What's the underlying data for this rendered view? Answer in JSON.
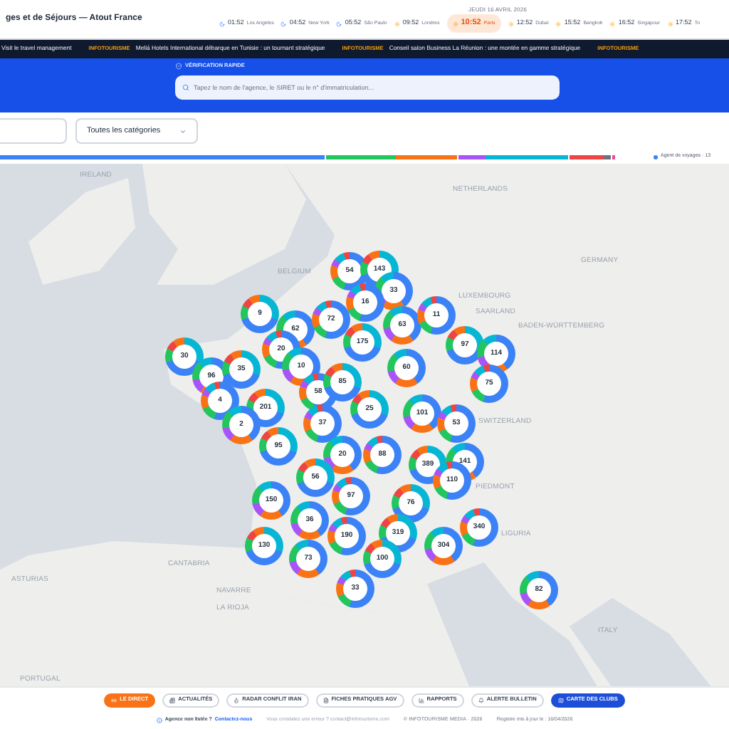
{
  "header": {
    "title": "ges et de Séjours — Atout France",
    "date": "JEUDI 16 AVRIL 2026",
    "clocks": [
      {
        "time": "01:52",
        "city": "Los Angeles",
        "kind": "night",
        "selected": false
      },
      {
        "time": "04:52",
        "city": "New York",
        "kind": "night",
        "selected": false
      },
      {
        "time": "05:52",
        "city": "São Paulo",
        "kind": "night",
        "selected": false
      },
      {
        "time": "09:52",
        "city": "Londres",
        "kind": "day",
        "selected": false
      },
      {
        "time": "10:52",
        "city": "Paris",
        "kind": "day",
        "selected": true
      },
      {
        "time": "12:52",
        "city": "Dubaï",
        "kind": "day",
        "selected": false
      },
      {
        "time": "15:52",
        "city": "Bangkok",
        "kind": "day",
        "selected": false
      },
      {
        "time": "16:52",
        "city": "Singapour",
        "kind": "day",
        "selected": false
      },
      {
        "time": "17:52",
        "city": "To",
        "kind": "day",
        "selected": false
      }
    ]
  },
  "ticker": [
    {
      "text": "Visit le travel management"
    },
    {
      "source": "INFOTOURISME",
      "text": "Meliá Hotels International débarque en Tunisie : un tournant stratégique"
    },
    {
      "source": "INFOTOURISME",
      "text": "Conseil salon Business La Réunion : une montée en gamme stratégique"
    },
    {
      "source": "INFOTOURISME"
    }
  ],
  "verification": {
    "title": "VÉRIFICATION RAPIDE",
    "placeholder": "Tapez le nom de l'agence, le SIRET ou le n° d'immatriculation..."
  },
  "filters": {
    "category": "Toutes les catégories"
  },
  "category_bar": [
    {
      "color": "#3b82f6"
    },
    {
      "color": "#22c55e"
    },
    {
      "color": "#f97316"
    },
    {
      "color": "#a855f7"
    },
    {
      "color": "#06b6d4"
    },
    {
      "color": "#ef4444"
    },
    {
      "color": "#6b7280"
    },
    {
      "color": "#ec4899"
    }
  ],
  "legend": {
    "label": "Agent de voyages · 13",
    "color": "#3b82f6"
  },
  "map": {
    "labels": [
      "IRELAND",
      "BELGIUM",
      "LUXEMBOURG",
      "SAARLAND",
      "BADEN-WÜRTTEMBERG",
      "SWITZERLAND",
      "PIEDMONT",
      "LIGURIA",
      "CANTABRIA",
      "NAVARRE",
      "LA RIOJA",
      "ASTURIAS",
      "PORTUGAL",
      "NETHERLANDS",
      "GERMANY",
      "ITALY"
    ],
    "clusters": [
      "54",
      "143",
      "33",
      "16",
      "9",
      "62",
      "72",
      "175",
      "63",
      "11",
      "97",
      "114",
      "75",
      "30",
      "96",
      "20",
      "35",
      "10",
      "58",
      "85",
      "60",
      "4",
      "201",
      "2",
      "37",
      "25",
      "101",
      "53",
      "95",
      "20",
      "88",
      "389",
      "141",
      "110",
      "56",
      "150",
      "97",
      "76",
      "36",
      "190",
      "319",
      "304",
      "340",
      "130",
      "73",
      "33",
      "100",
      "82"
    ]
  },
  "nav": [
    {
      "label": "LE DIRECT",
      "kind": "live",
      "selected": false
    },
    {
      "label": "ACTUALITÉS",
      "kind": "normal",
      "selected": false
    },
    {
      "label": "RADAR CONFLIT IRAN",
      "kind": "normal",
      "selected": false
    },
    {
      "label": "FICHES PRATIQUES AGV",
      "kind": "normal",
      "selected": false
    },
    {
      "label": "RAPPORTS",
      "kind": "normal",
      "selected": false
    },
    {
      "label": "ALERTE BULLETIN",
      "kind": "normal",
      "selected": false
    },
    {
      "label": "CARTE DES CLUBS",
      "kind": "normal",
      "selected": true
    }
  ],
  "footer": {
    "question": "Agence non listée ?",
    "link": "Contactez-nous",
    "error": "Vous constatez une erreur ? contact@infotourisme.com",
    "copyright": "© INFOTOURISME MEDIA · 2026",
    "updated": "Registre mis à jour le : 16/04/2026"
  }
}
